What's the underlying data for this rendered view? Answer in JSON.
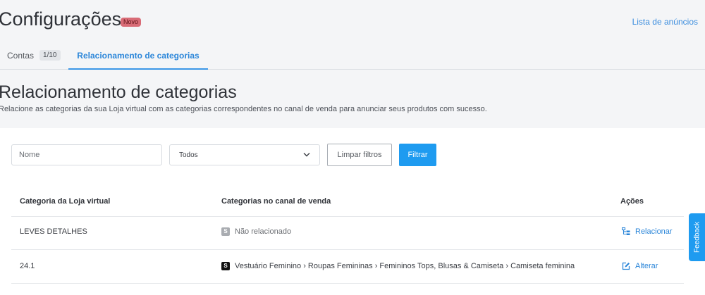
{
  "header": {
    "title": "Configurações",
    "badge": "Novo",
    "link": "Lista de anúncios"
  },
  "tabs": [
    {
      "label": "Contas",
      "count": "1/10",
      "active": false
    },
    {
      "label": "Relacionamento de categorias",
      "active": true
    }
  ],
  "page": {
    "title": "Relacionamento de categorias",
    "description": "Relacione as categorias da sua Loja virtual com as categorias correspondentes no canal de venda para anunciar seus produtos com sucesso."
  },
  "filters": {
    "name_placeholder": "Nome",
    "status_value": "Todos",
    "clear_label": "Limpar filtros",
    "filter_label": "Filtrar"
  },
  "table": {
    "headers": [
      "Categoria da Loja virtual",
      "Categorias no canal de venda",
      "Ações"
    ],
    "rows": [
      {
        "store_category": "LEVES DETALHES",
        "channel_icon": "S",
        "channel_category": "Não relacionado",
        "action": "Relacionar",
        "action_icon": "relate-icon"
      },
      {
        "store_category": "24.1",
        "channel_icon": "S",
        "channel_category": "Vestuário Feminino › Roupas Femininas › Femininos Tops, Blusas & Camiseta › Camiseta feminina",
        "action": "Alterar",
        "action_icon": "edit-icon"
      }
    ]
  },
  "feedback": {
    "label": "Feedback"
  },
  "colors": {
    "accent": "#1e9bf0",
    "link": "#2b86d9",
    "badge": "#d86b76",
    "background": "#f4f5f7"
  }
}
